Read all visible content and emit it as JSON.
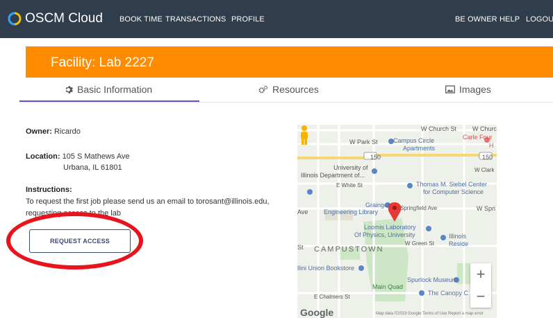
{
  "app": {
    "brand": "OSCM Cloud"
  },
  "nav": {
    "book_time": "BOOK TIME",
    "transactions": "TRANSACTIONS",
    "profile": "PROFILE",
    "be_owner": "BE OWNER",
    "help": "HELP",
    "logout": "LOGOU"
  },
  "facility": {
    "title": "Facility: Lab 2227"
  },
  "tabs": [
    {
      "label": "Basic Information",
      "icon": "gear-icon"
    },
    {
      "label": "Resources",
      "icon": "gears-icon"
    },
    {
      "label": "Images",
      "icon": "image-icon"
    }
  ],
  "details": {
    "owner_label": "Owner:",
    "owner_value": "Ricardo",
    "location_label": "Location:",
    "location_line1": "105 S Mathews Ave",
    "location_line2": "Urbana, IL 61801",
    "instructions_label": "Instructions:",
    "instructions_line1": "To request the first job please send us an email to torosant@illinois.edu,",
    "instructions_line2": "requesting access to the lab"
  },
  "request_button": {
    "label": "REQUEST ACCESS"
  },
  "map": {
    "labels": {
      "church_st_l": "W Church St",
      "church_st_r": "W Church St",
      "park_st": "W Park St",
      "campus_circle": "Campus Circle",
      "apartments": "Apartments",
      "carle": "Carle Four",
      "carle2": "H",
      "univ": "University of",
      "ill_dept": "Illinois Department of...",
      "e_white": "E White St",
      "w_clark": "W Clark",
      "siebel": "Thomas M. Siebel Center",
      "siebel2": "for Computer Science",
      "grainger": "Grainger",
      "eng_lib": "Engineering Library",
      "springfield": "Springfield Ave",
      "w_spr": "W Spri",
      "ave": "Ave",
      "loomis": "Loomis Laboratory",
      "loomis2": "Of Physics, University",
      "st": "St",
      "campustown": "CAMPUSTOWN",
      "green_st": "W Green St",
      "illinois_res": "Illinois",
      "illinois_res2": "Reside",
      "union": "llini Union Bookstore",
      "spurlock": "Spurlock Museum",
      "main_quad": "Main Quad",
      "chalmers": "E Chalmers St",
      "canopy": "The Canopy C",
      "google": "Google",
      "footer": "Map data ©2019 Google   Terms of Use   Report a map error",
      "route150_a": "150",
      "route150_b": "150"
    },
    "colors": {
      "road": "#ffffff",
      "highway": "#f7d774",
      "park": "#cde6c5",
      "pin": "#e53935",
      "poi_icon": "#5b86c5"
    }
  }
}
